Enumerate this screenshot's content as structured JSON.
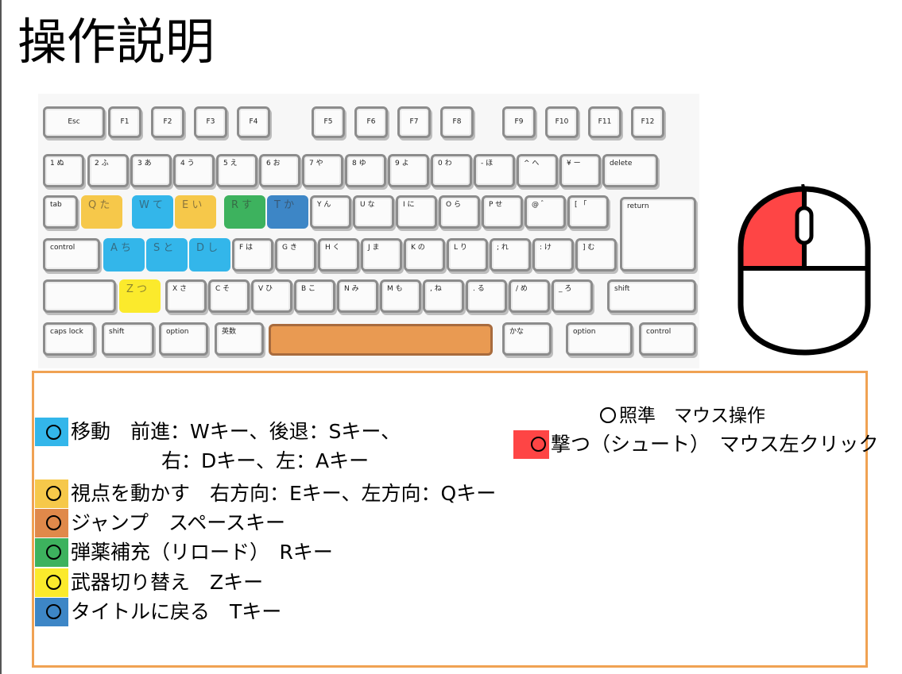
{
  "title": "操作説明",
  "keyboard": {
    "row0": [
      "Esc",
      "F1",
      "F2",
      "F3",
      "F4",
      "F5",
      "F6",
      "F7",
      "F8",
      "F9",
      "F10",
      "F11",
      "F12"
    ],
    "row1": [
      "1 ぬ",
      "2 ふ",
      "3 あ",
      "4 う",
      "5 え",
      "6 お",
      "7 や",
      "8 ゆ",
      "9 よ",
      "0 わ",
      "- ほ",
      "^ へ",
      "¥ ー",
      "delete"
    ],
    "row2": [
      "tab",
      "Q た",
      "W て",
      "E い",
      "R す",
      "T か",
      "Y ん",
      "U な",
      "I に",
      "O ら",
      "P せ",
      "@ ゛",
      "[ 「"
    ],
    "row3": [
      "control",
      "A ち",
      "S と",
      "D し",
      "F は",
      "G き",
      "H く",
      "J ま",
      "K の",
      "L り",
      "; れ",
      ": け",
      "] む",
      "return"
    ],
    "row4": [
      "",
      "Z つ",
      "X さ",
      "C そ",
      "V ひ",
      "B こ",
      "N み",
      "M も",
      ", ね",
      ". る",
      "/ め",
      "_ ろ",
      "shift"
    ],
    "row5": [
      "caps lock",
      "shift",
      "option",
      "英数",
      "",
      "かな",
      "option",
      "control"
    ]
  },
  "mouse": {
    "left_button_color": "#fe4545"
  },
  "legend": {
    "move_line1": "移動　前進：Wキー、後退：Sキー、",
    "move_line2": "右：Dキー、左：Aキー",
    "look": "視点を動かす　右方向：Eキー、左方向：Qキー",
    "jump": "ジャンプ　スペースキー",
    "reload": "弾薬補充（リロード）　Rキー",
    "switch": "武器切り替え　Zキー",
    "title_return": "タイトルに戻る　Tキー",
    "aim": "照準　マウス操作",
    "shoot": "撃つ（シュート）　マウス左クリック"
  },
  "colors": {
    "move": "#33b6ea",
    "look": "#f6c84a",
    "jump": "#e0894a",
    "reload": "#3db25e",
    "switch": "#fbea2c",
    "title_return": "#3d86c6",
    "shoot": "#fe4545",
    "panel_border": "#f0a253"
  }
}
